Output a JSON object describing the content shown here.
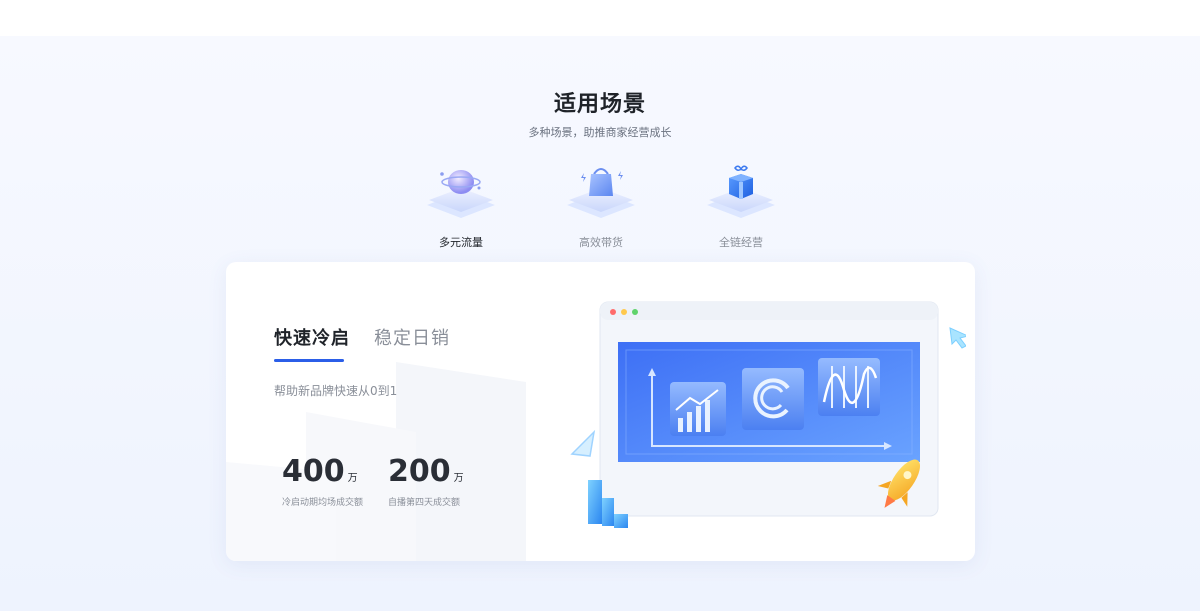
{
  "header": {
    "title": "适用场景",
    "subtitle": "多种场景，助推商家经营成长"
  },
  "scenarios": [
    {
      "label": "多元流量",
      "icon": "globe-platform-icon",
      "active": true
    },
    {
      "label": "高效带货",
      "icon": "shopping-bag-platform-icon",
      "active": false
    },
    {
      "label": "全链经营",
      "icon": "gift-box-platform-icon",
      "active": false
    }
  ],
  "panel": {
    "tabs": [
      {
        "label": "快速冷启",
        "active": true
      },
      {
        "label": "稳定日销",
        "active": false
      }
    ],
    "description": "帮助新品牌快速从0到1",
    "stats": [
      {
        "value": "400",
        "unit": "万",
        "caption": "冷启动期均场成交额"
      },
      {
        "value": "200",
        "unit": "万",
        "caption": "自播第四天成交额"
      }
    ]
  },
  "colors": {
    "accent": "#2b5ee8",
    "page_bg": "#f3f6fe",
    "card_bg": "#ffffff"
  }
}
